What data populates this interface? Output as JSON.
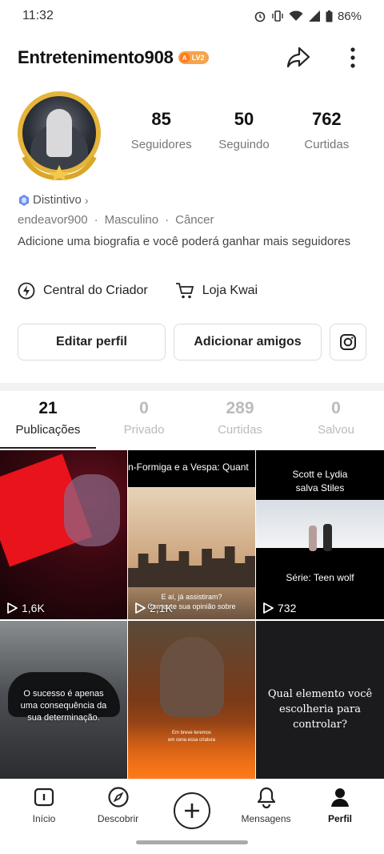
{
  "status": {
    "time": "11:32",
    "battery": "86%"
  },
  "header": {
    "username": "Entretenimento908",
    "level_badge": "LV2"
  },
  "stats": [
    {
      "value": "85",
      "label": "Seguidores"
    },
    {
      "value": "50",
      "label": "Seguindo"
    },
    {
      "value": "762",
      "label": "Curtidas"
    }
  ],
  "profile": {
    "badge_link": "Distintivo",
    "handle": "endeavor900",
    "gender": "Masculino",
    "sign": "Câncer",
    "bio": "Adicione uma biografia e você poderá ganhar mais seguidores"
  },
  "shortcuts": {
    "creator_center": "Central do Criador",
    "shop": "Loja Kwai"
  },
  "buttons": {
    "edit_profile": "Editar perfil",
    "add_friends": "Adicionar amigos"
  },
  "tabs": [
    {
      "count": "21",
      "label": "Publicações"
    },
    {
      "count": "0",
      "label": "Privado"
    },
    {
      "count": "289",
      "label": "Curtidas"
    },
    {
      "count": "0",
      "label": "Salvou"
    }
  ],
  "posts": [
    {
      "views": "1,6K"
    },
    {
      "top_text": "n-Formiga e a Vespa: Quant",
      "caption": "E aí, já assistiram?\nComente sua opinião sobre",
      "views": "2,1K"
    },
    {
      "title": "Scott e Lydia\nsalva Stiles",
      "series": "Série: Teen wolf",
      "views": "732"
    },
    {
      "quote": "O sucesso é apenas\numa consequência da\nsua determinação."
    },
    {
      "small_caption": "Em breve teremos\nem cena essa criatura"
    },
    {
      "question": "Qual elemento você\nescolheria para\ncontrolar?"
    }
  ],
  "nav": [
    {
      "label": "Início",
      "icon": "home-icon"
    },
    {
      "label": "Descobrir",
      "icon": "compass-icon"
    },
    {
      "label": "",
      "icon": "plus-icon"
    },
    {
      "label": "Mensagens",
      "icon": "bell-icon"
    },
    {
      "label": "Perfil",
      "icon": "person-icon"
    }
  ],
  "colors": {
    "accent_gold": "#e5b43a",
    "badge_orange": "#f5a44a",
    "badge_blue": "#6a8df0"
  }
}
